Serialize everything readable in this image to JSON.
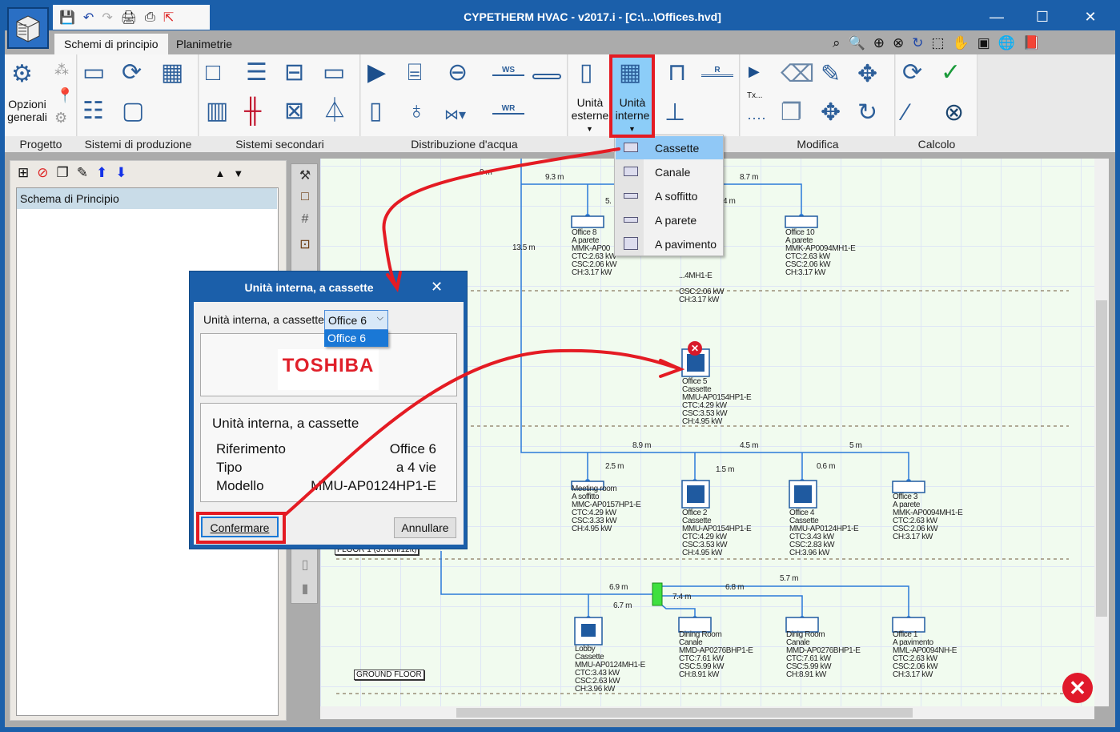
{
  "window": {
    "title": "CYPETHERM HVAC - v2017.i - [C:\\...\\Offices.hvd]",
    "minimize": "—",
    "maximize": "☐",
    "close": "✕"
  },
  "tabs": [
    {
      "label": "Schemi di principio",
      "active": true
    },
    {
      "label": "Planimetrie",
      "active": false
    }
  ],
  "ribbon": {
    "groups": [
      "Progetto",
      "Sistemi di produzione",
      "Sistemi secondari",
      "Distribuzione d'acqua",
      "Modifica",
      "Calcolo"
    ],
    "opzioni_generali": "Opzioni generali",
    "unita_esterne": "Unità esterne",
    "unita_interne": "Unità interne",
    "ws": "WS",
    "wr": "WR",
    "r": "R",
    "tx": "Tx..."
  },
  "dropdown_menu": {
    "items": [
      {
        "label": "Cassette",
        "selected": true
      },
      {
        "label": "Canale"
      },
      {
        "label": "A soffitto"
      },
      {
        "label": "A parete"
      },
      {
        "label": "A pavimento"
      }
    ]
  },
  "left_panel": {
    "items": [
      "Schema di Principio"
    ]
  },
  "diagram": {
    "distances": [
      "9 m",
      "9.3 m",
      "5.",
      "4 m",
      "8.7 m",
      "13.5 m",
      "8.9 m",
      "4.5 m",
      "5 m",
      "2.5 m",
      "1.5 m",
      "0.6 m",
      "6.9 m",
      "6.7 m",
      "7.4 m",
      "6.8 m",
      "5.7 m"
    ],
    "floors": [
      "FLOOR 1 (3.70m/12ft)",
      "GROUND FLOOR"
    ],
    "units": [
      {
        "lines": [
          "Office 8",
          "A parete",
          "MMK-AP00",
          "CTC:2.63 kW",
          "CSC:2.06 kW",
          "CH:3.17 kW"
        ]
      },
      {
        "lines": [
          "",
          "",
          "...4MH1-E",
          "",
          "CSC:2.06 kW",
          "CH:3.17 kW"
        ]
      },
      {
        "lines": [
          "Office 10",
          "A parete",
          "MMK-AP0094MH1-E",
          "CTC:2.63 kW",
          "CSC:2.06 kW",
          "CH:3.17 kW"
        ]
      },
      {
        "lines": [
          "Office 5",
          "Cassette",
          "MMU-AP0154HP1-E",
          "CTC:4.29 kW",
          "CSC:3.53 kW",
          "CH:4.95 kW"
        ],
        "error": true
      },
      {
        "lines": [
          "Meeting room",
          "A soffitto",
          "MMC-AP0157HP1-E",
          "CTC:4.29 kW",
          "CSC:3.33 kW",
          "CH:4.95 kW"
        ]
      },
      {
        "lines": [
          "Office 2",
          "Cassette",
          "MMU-AP0154HP1-E",
          "CTC:4.29 kW",
          "CSC:3.53 kW",
          "CH:4.95 kW"
        ]
      },
      {
        "lines": [
          "Office 4",
          "Cassette",
          "MMU-AP0124HP1-E",
          "CTC:3.43 kW",
          "CSC:2.83 kW",
          "CH:3.96 kW"
        ]
      },
      {
        "lines": [
          "Office 3",
          "A parete",
          "MMK-AP0094MH1-E",
          "CTC:2.63 kW",
          "CSC:2.06 kW",
          "CH:3.17 kW"
        ]
      },
      {
        "lines": [
          "Lobby",
          "Cassette",
          "MMU-AP0124MH1-E",
          "CTC:3.43 kW",
          "CSC:2.63 kW",
          "CH:3.96 kW"
        ]
      },
      {
        "lines": [
          "Dining Room",
          "Canale",
          "MMD-AP0276BHP1-E",
          "CTC:7.61 kW",
          "CSC:5.99 kW",
          "CH:8.91 kW"
        ]
      },
      {
        "lines": [
          "Dinig Room",
          "Canale",
          "MMD-AP0276BHP1-E",
          "CTC:7.61 kW",
          "CSC:5.99 kW",
          "CH:8.91 kW"
        ]
      },
      {
        "lines": [
          "Office 1",
          "A pavimento",
          "MML-AP0094NH-E",
          "CTC:2.63 kW",
          "CSC:2.06 kW",
          "CH:3.17 kW"
        ]
      }
    ]
  },
  "dialog": {
    "title": "Unità interna, a cassette",
    "select_label": "Unità interna, a cassette",
    "select_value": "Office 6",
    "select_option": "Office 6",
    "brand_logo": "TOSHIBA",
    "info_title": "Unità interna, a cassette",
    "rows": [
      {
        "k": "Riferimento",
        "v": "Office 6"
      },
      {
        "k": "Tipo",
        "v": "a 4 vie"
      },
      {
        "k": "Modello",
        "v": "MMU-AP0124HP1-E"
      }
    ],
    "confirm": "Confermare",
    "cancel": "Annullare"
  },
  "colors": {
    "titlebar": "#1b5faa",
    "pipe": "#2b7bd8",
    "annotation": "#e41b23",
    "menu_selected": "#90c8f6",
    "brand": "#e0202a"
  }
}
